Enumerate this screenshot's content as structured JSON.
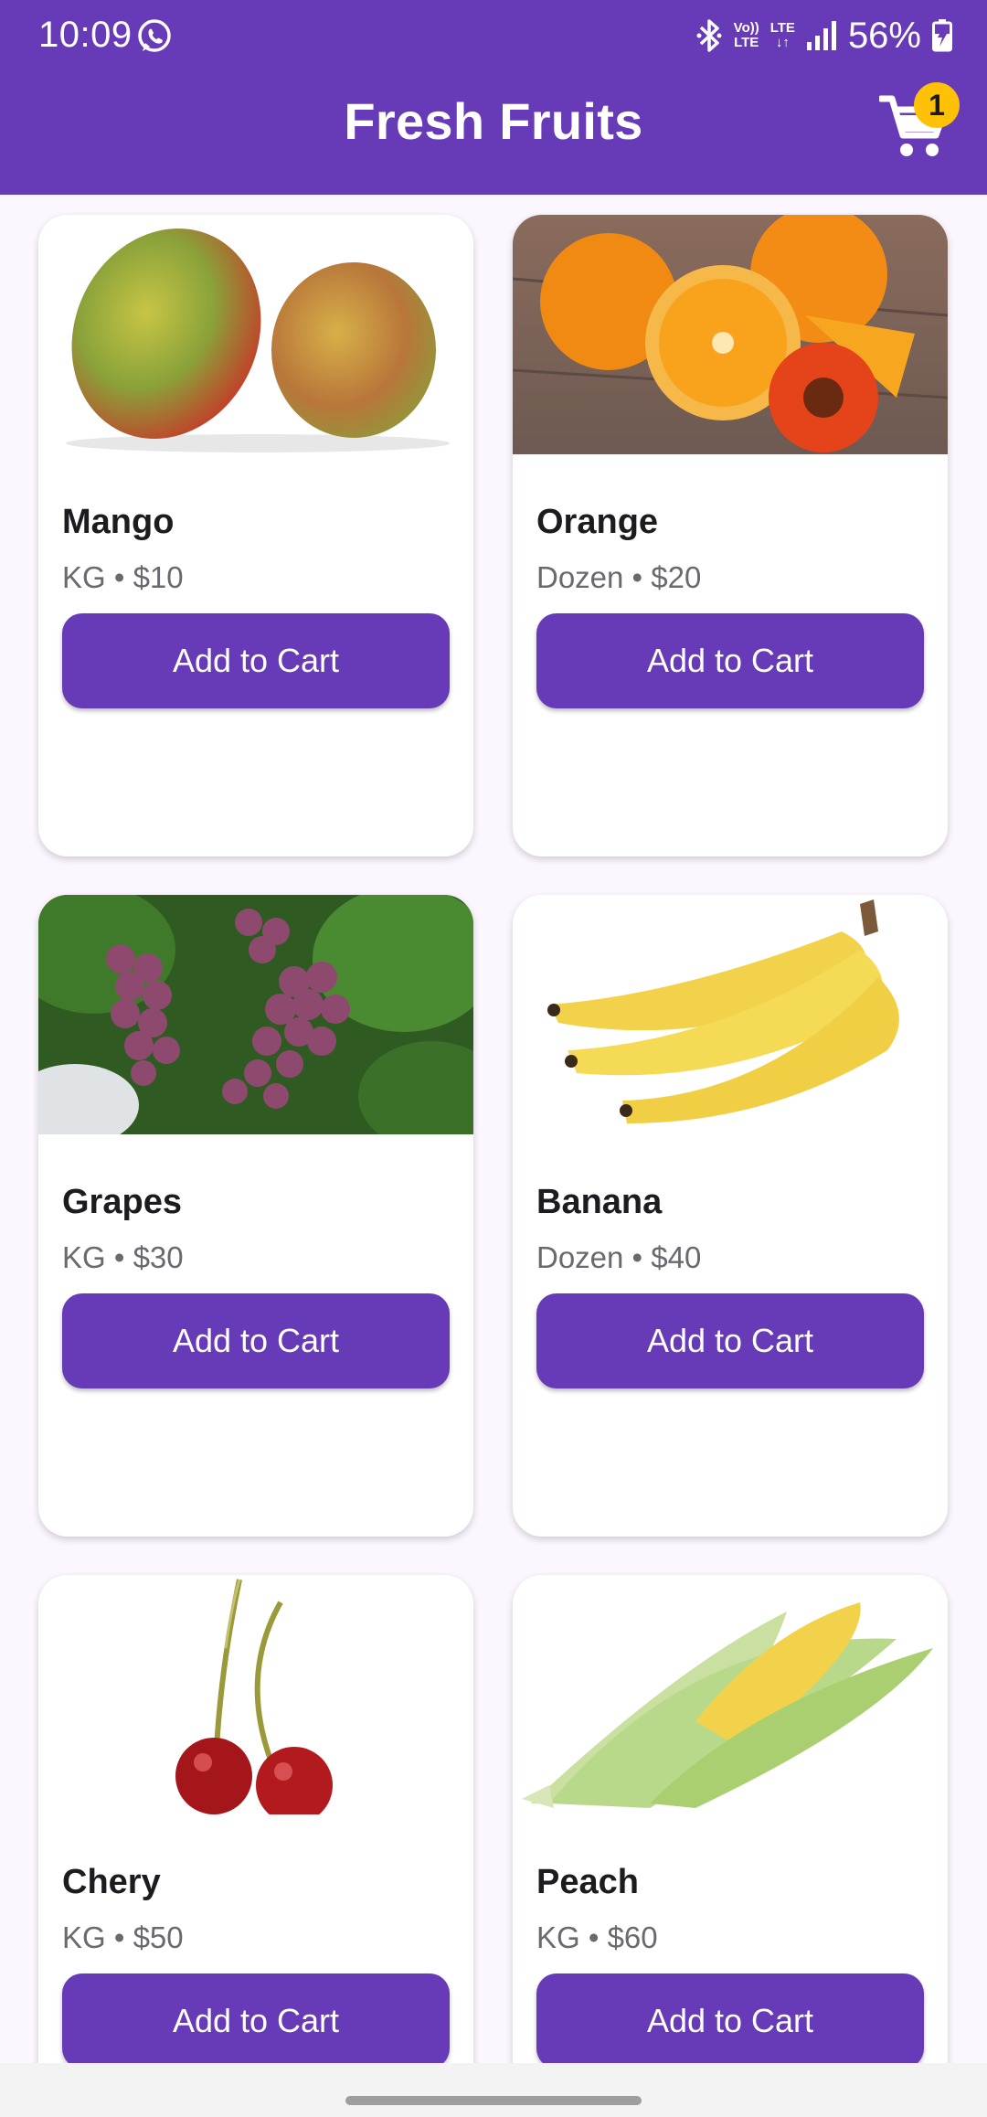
{
  "status_bar": {
    "time": "10:09",
    "volte_top": "Vo))",
    "volte_bottom": "LTE",
    "lte_top": "LTE",
    "lte_bottom": "↓↑",
    "battery": "56%",
    "icons": [
      "whatsapp-icon",
      "bluetooth-icon",
      "signal-icon",
      "battery-charging-icon"
    ]
  },
  "app_bar": {
    "title": "Fresh Fruits",
    "cart_badge": "1",
    "cart_icon": "shopping-cart-icon"
  },
  "products": [
    {
      "name": "Mango",
      "meta": "KG • $10",
      "button": "Add to Cart",
      "image": "mango"
    },
    {
      "name": "Orange",
      "meta": "Dozen • $20",
      "button": "Add to Cart",
      "image": "orange"
    },
    {
      "name": "Grapes",
      "meta": "KG • $30",
      "button": "Add to Cart",
      "image": "grapes"
    },
    {
      "name": "Banana",
      "meta": "Dozen • $40",
      "button": "Add to Cart",
      "image": "banana"
    },
    {
      "name": "Chery",
      "meta": "KG • $50",
      "button": "Add to Cart",
      "image": "cherry"
    },
    {
      "name": "Peach",
      "meta": "KG • $60",
      "button": "Add to Cart",
      "image": "corn"
    }
  ],
  "colors": {
    "primary": "#673AB7",
    "badge": "#FFC107",
    "background": "#FCF6FE",
    "card": "#FFFFFF"
  }
}
